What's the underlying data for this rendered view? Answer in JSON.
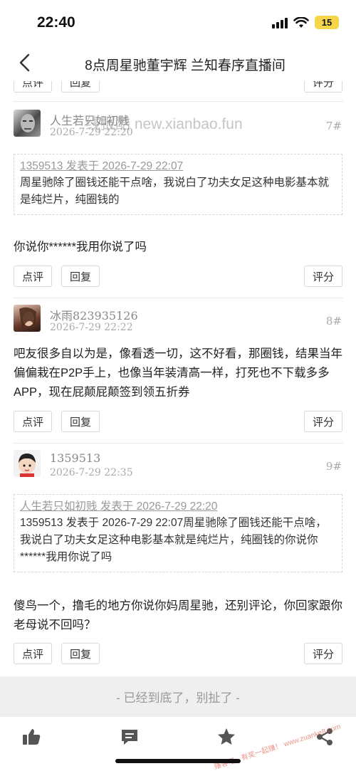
{
  "status_bar": {
    "time": "22:40",
    "battery": "15"
  },
  "nav": {
    "title": "8点周星驰董宇辉 兰知春序直播间"
  },
  "watermark": "线报酷 new.xianbao.fun",
  "buttons": {
    "comment": "点评",
    "reply": "回复",
    "rate": "评分"
  },
  "posts": [
    {
      "username": "人生若只如初贱",
      "time": "2026-7-29 22:20",
      "floor": "7#",
      "quote_head": "1359513 发表于 2026-7-29 22:07",
      "quote_body": "周星驰除了圈钱还能干点啥，我说白了功夫女足这种电影基本就是纯烂片，纯圈钱的",
      "text": "你说你******我用你说了吗"
    },
    {
      "username": "冰雨823935126",
      "time": "2026-7-29 22:22",
      "floor": "8#",
      "text": "吧友很多自以为是，像看透一切，这不好看，那圈钱，结果当年偏偏栽在P2P手上，也像当年装清高一样，打死也不下载多多APP，现在屁颠屁颠签到领五折券"
    },
    {
      "username": "1359513",
      "time": "2026-7-29 22:35",
      "floor": "9#",
      "quote_head": "人生若只如初贱 发表于 2026-7-29 22:20",
      "quote_body": "1359513 发表于 2026-7-29 22:07周星驰除了圈钱还能干点啥，我说白了功夫女足这种电影基本就是纯烂片，纯圈钱的你说你******我用你说了吗",
      "text": "傻鸟一个，撸毛的地方你说你妈周星驰，还别评论，你回家跟你老母说不回吗？"
    }
  ],
  "end_text": "- 已经到底了，别扯了 -",
  "corner_watermark": "赚客吧，有奖一起赚！ www.zuanke8.com",
  "tabbar": [
    "thumbs-up-icon",
    "comment-icon",
    "star-icon",
    "share-icon"
  ]
}
